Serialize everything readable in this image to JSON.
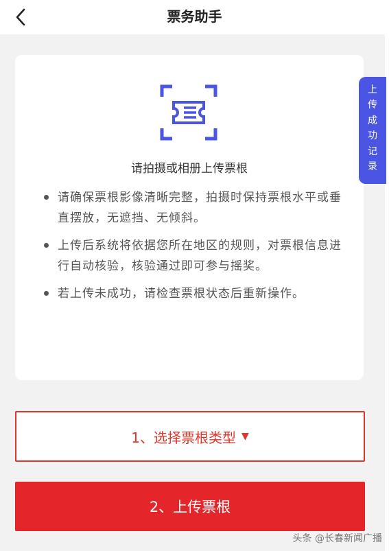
{
  "header": {
    "title": "票务助手",
    "back_icon": "chevron-left-icon"
  },
  "card": {
    "icon": "ticket-scan-icon",
    "accent_color": "#4a55e3",
    "title": "请拍摄或相册上传票根",
    "tips": [
      "请确保票根影像清晰完整，拍摄时保持票根水平或垂直摆放，无遮挡、无倾斜。",
      "上传后系统将依据您所在地区的规则，对票根信息进行自动核验，核验通过即可参与摇奖。",
      "若上传未成功，请检查票根状态后重新操作。"
    ]
  },
  "side_tab": {
    "label": "上\n传\n成\n功\n记\n录"
  },
  "buttons": {
    "select_type": "1、选择票根类型",
    "select_caret": "▼",
    "upload": "2、上传票根",
    "primary_color": "#e4262a"
  },
  "watermark": "头条 @长春新闻广播"
}
